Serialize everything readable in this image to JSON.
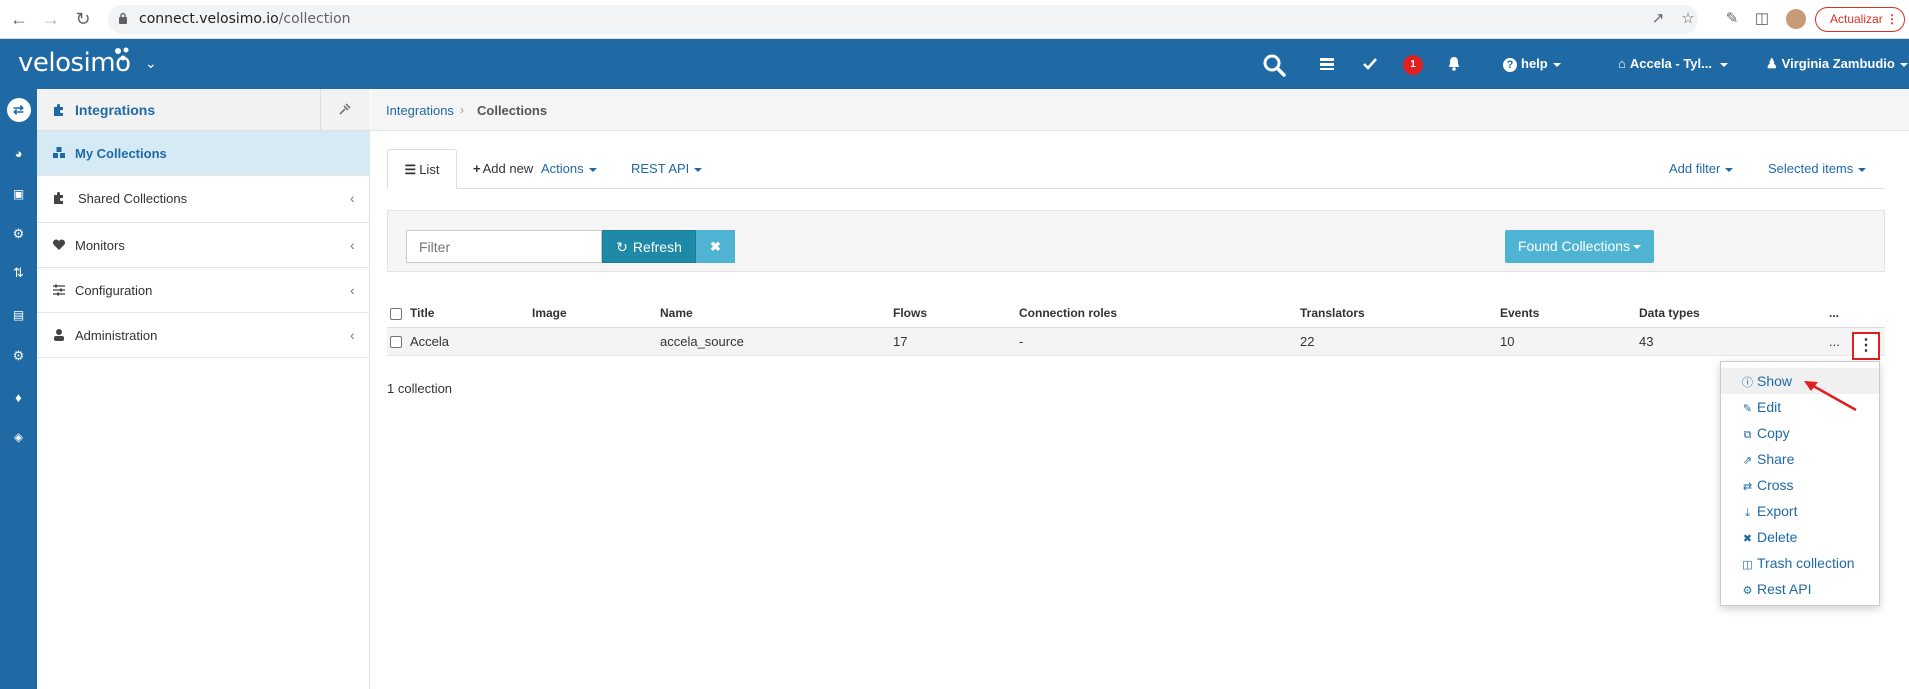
{
  "browser": {
    "url_host": "connect.velosimo.io",
    "url_path": "/collection",
    "update_label": "Actualizar"
  },
  "topnav": {
    "brand": "velosimo",
    "notification_count": "1",
    "help_label": "help",
    "tenant_label": "Accela - Tyl...",
    "user_label": "Virginia Zambudio"
  },
  "sidebar": {
    "header": "Integrations",
    "items": [
      {
        "label": "My Collections",
        "icon": "cubes-icon",
        "active": true
      },
      {
        "label": "Shared Collections",
        "icon": "puzzle-icon"
      },
      {
        "label": "Monitors",
        "icon": "heartbeat-icon"
      },
      {
        "label": "Configuration",
        "icon": "sliders-icon"
      },
      {
        "label": "Administration",
        "icon": "user-secret-icon"
      }
    ]
  },
  "breadcrumb": {
    "parent": "Integrations",
    "current": "Collections"
  },
  "tabs": {
    "list": "List",
    "add_new": "Add new",
    "actions": "Actions",
    "rest_api": "REST API",
    "add_filter": "Add filter",
    "selected_items": "Selected items"
  },
  "filterbar": {
    "placeholder": "Filter",
    "refresh": "Refresh",
    "found": "Found Collections"
  },
  "table": {
    "headers": [
      "Title",
      "Image",
      "Name",
      "Flows",
      "Connection roles",
      "Translators",
      "Events",
      "Data types",
      "..."
    ],
    "rows": [
      {
        "title": "Accela",
        "image": "",
        "name": "accela_source",
        "flows": "17",
        "connection_roles": "-",
        "translators": "22",
        "events": "10",
        "data_types": "43",
        "more": "..."
      }
    ]
  },
  "count_label": "1 collection",
  "row_menu": {
    "items": [
      "Show",
      "Edit",
      "Copy",
      "Share",
      "Cross",
      "Export",
      "Delete",
      "Trash collection",
      "Rest API"
    ]
  },
  "colors": {
    "brand": "#1f6aa5",
    "refresh": "#1e8aa8",
    "info": "#4fb3d4",
    "alert": "#e02020"
  }
}
